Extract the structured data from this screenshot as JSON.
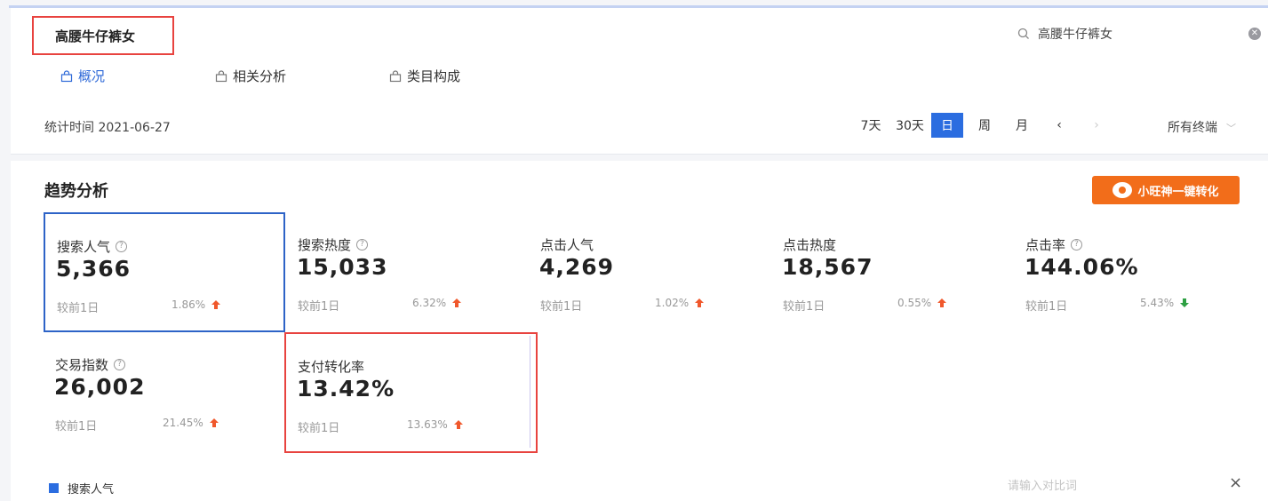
{
  "header": {
    "keyword": "高腰牛仔裤女",
    "search_value": "高腰牛仔裤女"
  },
  "tabs": [
    {
      "label": "概况",
      "active": true
    },
    {
      "label": "相关分析",
      "active": false
    },
    {
      "label": "类目构成",
      "active": false
    }
  ],
  "stat_time": "统计时间 2021-06-27",
  "period": {
    "options": [
      "7天",
      "30天",
      "日",
      "周",
      "月"
    ],
    "selected": "日",
    "prev": "‹",
    "next": "›",
    "terminal": "所有终端"
  },
  "trend": {
    "title": "趋势分析",
    "convert_button": "小旺神一键转化",
    "metrics": [
      {
        "label": "搜索人气",
        "value": "5,366",
        "compare": "较前1日",
        "change": "1.86%",
        "direction": "up",
        "help": true
      },
      {
        "label": "搜索热度",
        "value": "15,033",
        "compare": "较前1日",
        "change": "6.32%",
        "direction": "up",
        "help": true
      },
      {
        "label": "点击人气",
        "value": "4,269",
        "compare": "较前1日",
        "change": "1.02%",
        "direction": "up",
        "help": false
      },
      {
        "label": "点击热度",
        "value": "18,567",
        "compare": "较前1日",
        "change": "0.55%",
        "direction": "up",
        "help": false
      },
      {
        "label": "点击率",
        "value": "144.06%",
        "compare": "较前1日",
        "change": "5.43%",
        "direction": "down",
        "help": true
      },
      {
        "label": "交易指数",
        "value": "26,002",
        "compare": "较前1日",
        "change": "21.45%",
        "direction": "up",
        "help": true
      },
      {
        "label": "支付转化率",
        "value": "13.42%",
        "compare": "较前1日",
        "change": "13.63%",
        "direction": "up",
        "help": false
      }
    ],
    "legend_label": "搜索人气",
    "compare_placeholder": "请输入对比词",
    "close": "×"
  },
  "colors": {
    "accent": "#2b6de0",
    "up": "#f0582c",
    "down": "#2ea043",
    "highlight_red": "#e8433f",
    "convert_orange": "#f26d1a"
  }
}
